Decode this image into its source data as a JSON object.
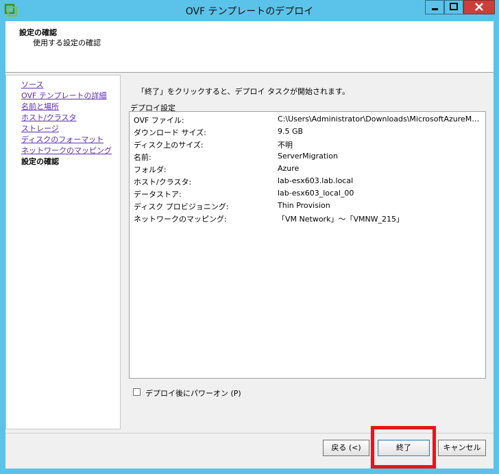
{
  "window": {
    "title": "OVF テンプレートのデプロイ",
    "icon": "vsphere-logo-icon",
    "controls": [
      "minimize-icon",
      "maximize-icon",
      "close-icon"
    ]
  },
  "header": {
    "title": "設定の確認",
    "subtitle": "使用する設定の確認"
  },
  "nav": {
    "items": [
      {
        "label": "ソース",
        "current": false
      },
      {
        "label": "OVF テンプレートの詳細",
        "current": false
      },
      {
        "label": "名前と場所",
        "current": false
      },
      {
        "label": "ホスト/クラスタ",
        "current": false
      },
      {
        "label": "ストレージ",
        "current": false
      },
      {
        "label": "ディスクのフォーマット",
        "current": false
      },
      {
        "label": "ネットワークのマッピング",
        "current": false
      },
      {
        "label": "設定の確認",
        "current": true
      }
    ]
  },
  "content": {
    "instruction": "「終了」をクリックすると、デプロイ タスクが開始されます。",
    "group_label": "デプロイ設定",
    "details": [
      {
        "key": "OVF ファイル:",
        "value": "C:\\Users\\Administrator\\Downloads\\MicrosoftAzureMigrati..."
      },
      {
        "key": "ダウンロード サイズ:",
        "value": "9.5 GB"
      },
      {
        "key": "ディスク上のサイズ:",
        "value": "不明"
      },
      {
        "key": "名前:",
        "value": "ServerMigration"
      },
      {
        "key": "フォルダ:",
        "value": "Azure"
      },
      {
        "key": "ホスト/クラスタ:",
        "value": "lab-esx603.lab.local"
      },
      {
        "key": "データストア:",
        "value": "lab-esx603_local_00"
      },
      {
        "key": "ディスク プロビジョニング:",
        "value": "Thin Provision"
      },
      {
        "key": "ネットワークのマッピング:",
        "value": "「VM Network」～「VMNW_215」"
      }
    ],
    "power_on_label": "デプロイ後にパワーオン (P)",
    "power_on_checked": false
  },
  "buttons": {
    "back": "戻る (<)",
    "finish": "終了",
    "cancel": "キャンセル"
  },
  "colors": {
    "titlebar": "#5bc3ea",
    "close_button": "#c9403b",
    "link": "#5b2cb0",
    "highlight": "#e8141b"
  }
}
